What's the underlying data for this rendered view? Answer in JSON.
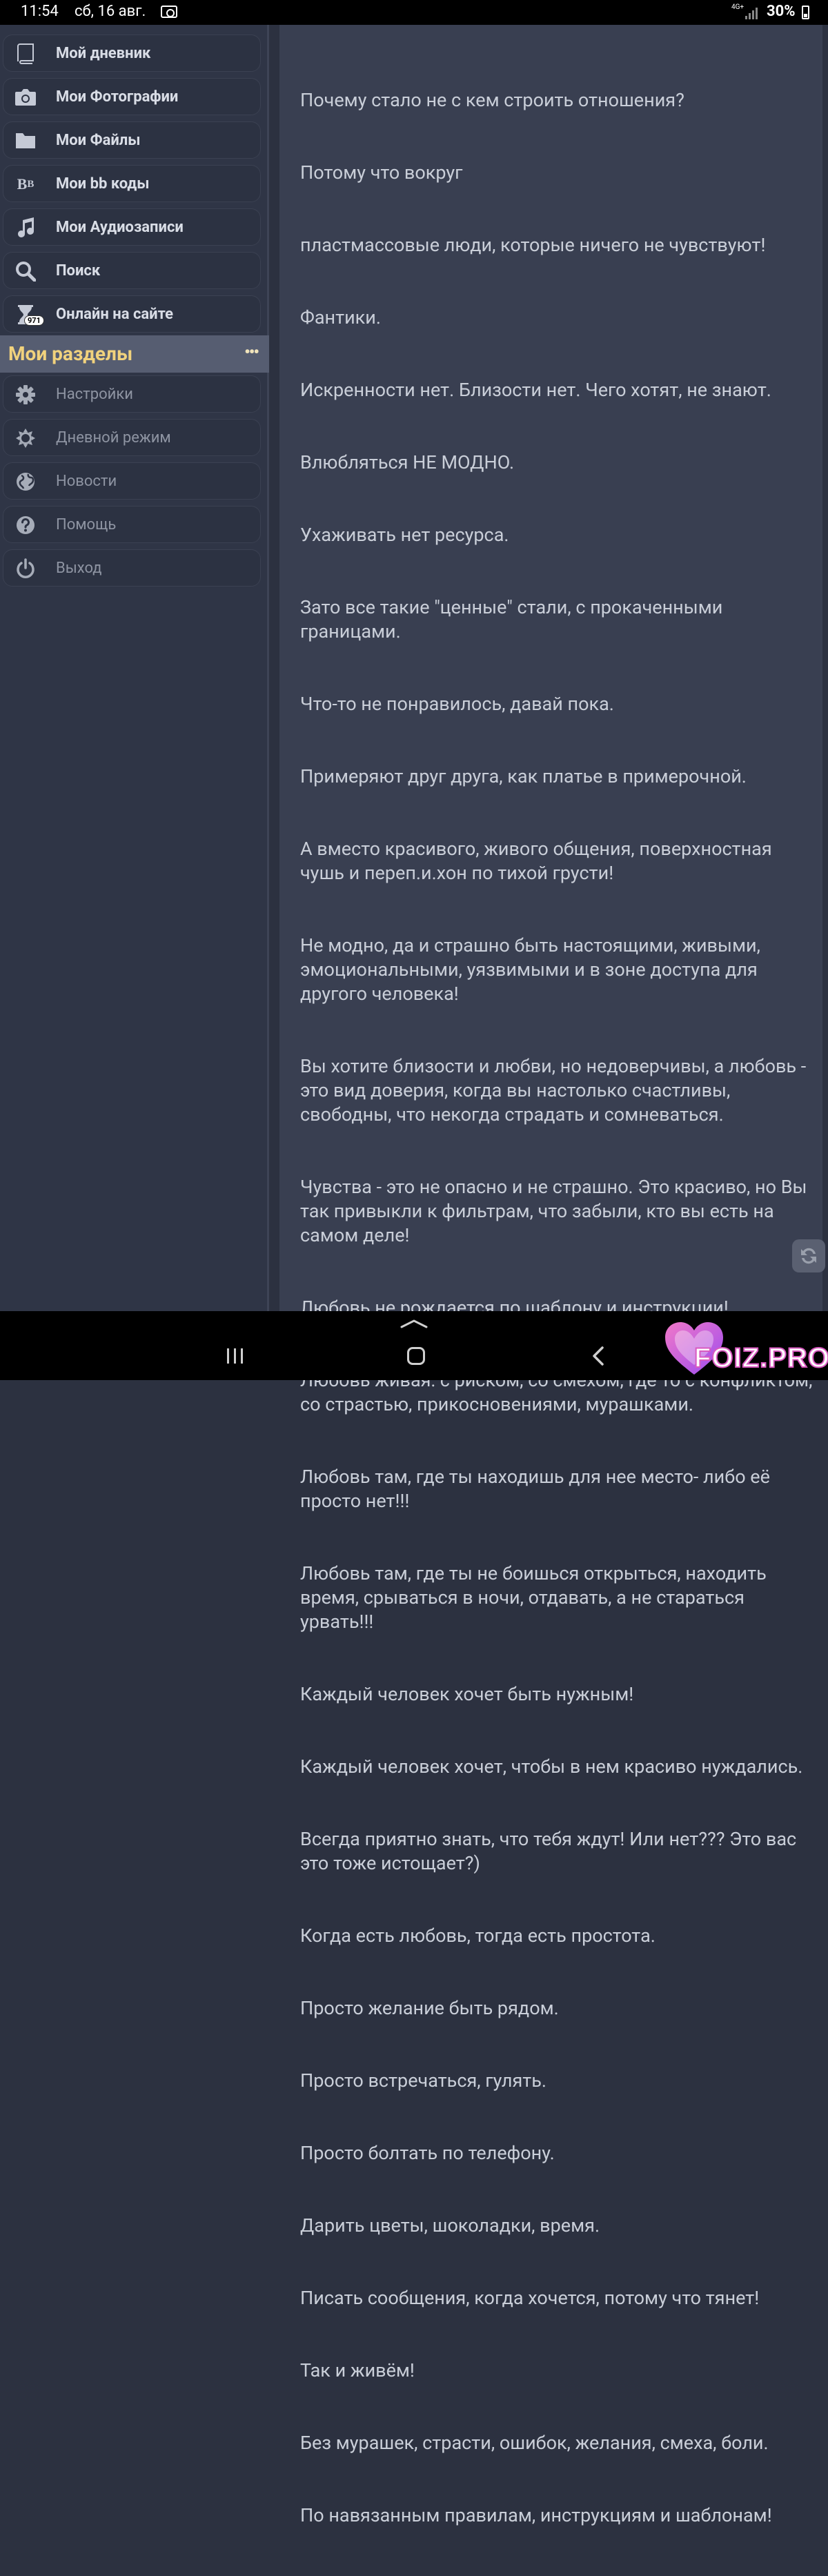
{
  "status_bar": {
    "time": "11:54",
    "date": "сб, 16 авг.",
    "network": "4G+",
    "battery": "30%"
  },
  "sidebar": {
    "items": [
      {
        "label": "Мой дневник",
        "icon": "book-icon"
      },
      {
        "label": "Мои Фотографии",
        "icon": "camera-icon"
      },
      {
        "label": "Мои Файлы",
        "icon": "folder-icon"
      },
      {
        "label": "Мои bb коды",
        "icon": "bb-code-icon"
      },
      {
        "label": "Мои Аудиозаписи",
        "icon": "music-note-icon"
      },
      {
        "label": "Поиск",
        "icon": "search-icon"
      },
      {
        "label": "Онлайн на сайте",
        "icon": "hourglass-icon",
        "badge": "971"
      }
    ],
    "section_title": "Мои разделы",
    "section_more": "•••",
    "section_items": [
      {
        "label": "Настройки",
        "icon": "gear-icon"
      },
      {
        "label": "Дневной режим",
        "icon": "sun-icon"
      },
      {
        "label": "Новости",
        "icon": "globe-icon"
      },
      {
        "label": "Помощь",
        "icon": "question-icon"
      },
      {
        "label": "Выход",
        "icon": "power-icon"
      }
    ]
  },
  "content": {
    "lines": [
      "Почему стало не с кем строить отношения?",
      "Потому что вокруг",
      "пластмассовые люди, которые ничего не чувствуют!",
      "Фантики.",
      "Искренности нет. Близости нет. Чего хотят, не знают.",
      "Влюбляться НЕ МОДНО.",
      "Ухаживать нет ресурса.",
      "Зато все такие \"ценные\" стали, с прокаченными границами.",
      "Что-то не понравилось, давай пока.",
      "Примеряют друг друга, как платье в примерочной.",
      "А вместо красивого, живого общения, поверхностная чушь и переп.и.хон по тихой грусти!",
      "Не модно, да и страшно быть настоящими, живыми, эмоциональными, уязвимыми и в зоне доступа для другого человека!",
      "Вы хотите близости и любви, но недоверчивы, а любовь - это вид доверия, когда вы настолько счастливы, свободны, что некогда страдать и сомневаться.",
      "Чувства - это не опасно и не страшно. Это красиво, но Вы так привыкли к фильтрам, что забыли, кто вы есть на самом деле!",
      "Любовь не рождается по шаблону и инструкции!",
      "Любовь живая: с риском, со смехом, где то с конфликтом, со страстью, прикосновениями, мурашками.",
      "Любовь там, где ты находишь для нее место- либо её просто нет!!!",
      "Любовь там, где ты не боишься открыться, находить время, срываться в ночи, отдавать, а не стараться урвать!!!",
      "Каждый человек хочет быть нужным!",
      "Каждый человек хочет, чтобы в нем красиво нуждались.",
      "Всегда приятно знать, что тебя ждут! Или нет??? Это вас это тоже истощает?)",
      "Когда есть любовь, тогда есть простота.",
      "Просто желание быть рядом.",
      "Просто встречаться, гулять.",
      "Просто болтать по телефону.",
      "Дарить цветы, шоколадки, время.",
      "Писать сообщения, когда хочется, потому что тянет!",
      "Так и живём!",
      "Без мурашек, страсти, ошибок, желания, смеха, боли.",
      "По навязанным правилам, инструкциям и шаблонам!"
    ]
  },
  "watermark": {
    "brand": "FOIZ.PRO"
  },
  "colors": {
    "section_title": "#f1d27d",
    "background": "#2c3140",
    "content_bg": "#393f51"
  }
}
